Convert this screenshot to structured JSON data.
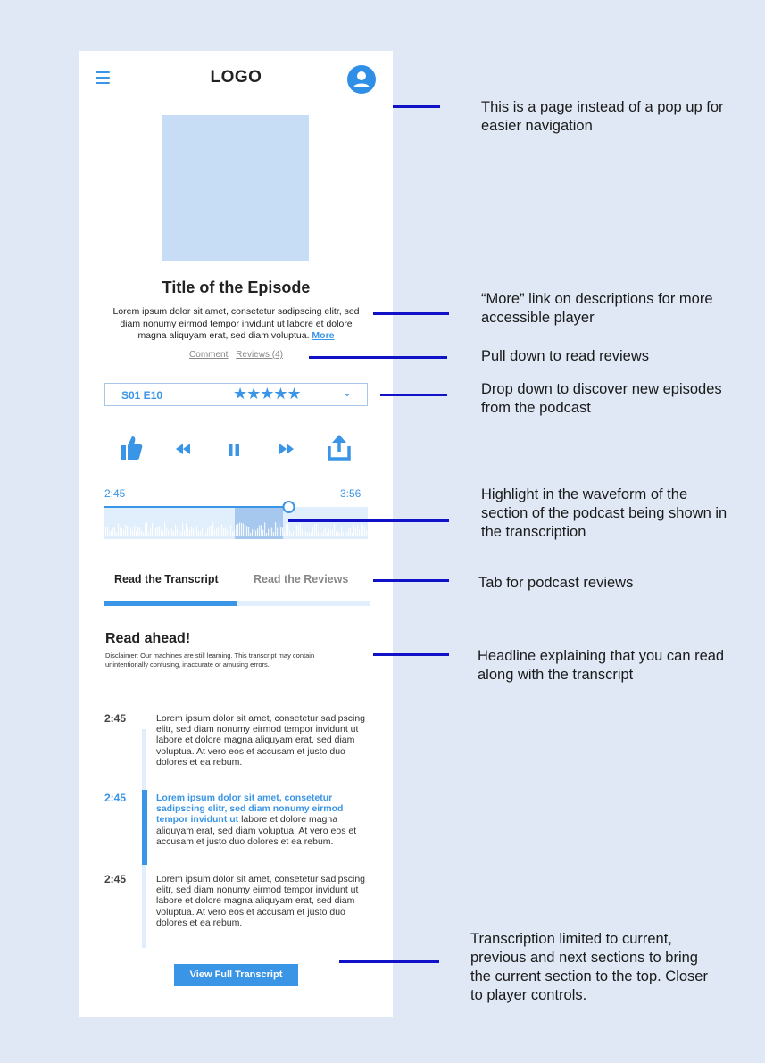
{
  "header": {
    "logo": "LOGO",
    "menu_icon": "hamburger-menu-icon",
    "avatar_icon": "user-avatar-icon"
  },
  "episode": {
    "title": "Title of the Episode",
    "description": "Lorem ipsum dolor sit amet, consetetur sadipscing elitr, sed diam nonumy eirmod tempor invidunt ut labore et dolore magna aliquyam erat, sed diam voluptua.",
    "more_label": "More",
    "comment_label": "Comment",
    "reviews_label": "Reviews (4)"
  },
  "episode_selector": {
    "season_episode": "S01 E10",
    "stars": "★★★★★",
    "rating": 5,
    "chevron_icon": "chevron-down-icon"
  },
  "controls": {
    "like_icon": "thumbs-up-icon",
    "rewind_icon": "rewind-icon",
    "pause_icon": "pause-icon",
    "forward_icon": "fast-forward-icon",
    "share_icon": "share-icon"
  },
  "progress": {
    "current_time": "2:45",
    "total_time": "3:56",
    "fraction": 0.7
  },
  "tabs": [
    {
      "label": "Read the Transcript",
      "active": true
    },
    {
      "label": "Read the Reviews",
      "active": false
    }
  ],
  "transcript": {
    "heading": "Read ahead!",
    "disclaimer": "Disclaimer: Our machines are still learning. This transcript may contain unintentionally confusing, inaccurate or amusing errors.",
    "segments": [
      {
        "time": "2:45",
        "highlight": "",
        "text": "Lorem ipsum dolor sit amet, consetetur sadipscing elitr, sed diam nonumy eirmod tempor invidunt ut labore et dolore magna aliquyam erat, sed diam voluptua. At vero eos et accusam et justo duo dolores et ea rebum."
      },
      {
        "time": "2:45",
        "highlight": "Lorem ipsum dolor sit amet, consetetur sadipscing elitr, sed diam nonumy eirmod tempor invidunt ut",
        "text": " labore et dolore magna aliquyam erat, sed diam voluptua. At vero eos et accusam et justo duo dolores et ea rebum."
      },
      {
        "time": "2:45",
        "highlight": "",
        "text": "Lorem ipsum dolor sit amet, consetetur sadipscing elitr, sed diam nonumy eirmod tempor invidunt ut labore et dolore magna aliquyam erat, sed diam voluptua. At vero eos et accusam et justo duo dolores et ea rebum."
      }
    ],
    "view_full_label": "View Full Transcript"
  },
  "annotations": [
    "This is a page instead of a pop up for easier navigation",
    "“More” link on descriptions for more accessible player",
    "Pull down to read reviews",
    "Drop down to discover new episodes from the podcast",
    "Highlight in the waveform of the section of the podcast being shown in the transcription",
    "Tab for podcast reviews",
    "Headline explaining that you can read along with the transcript",
    "Transcription limited to current, previous and next sections to bring the current section to the top. Closer to player controls."
  ],
  "colors": {
    "accent": "#3b95e6",
    "light_accent": "#c7ddf6",
    "background": "#dfe8f4",
    "annotation_line": "#1111c8"
  }
}
